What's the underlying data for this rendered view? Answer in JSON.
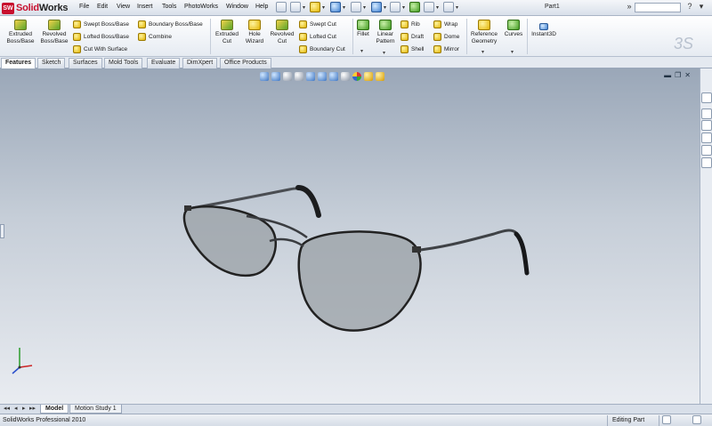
{
  "app": {
    "name_prefix": "Solid",
    "name_suffix": "Works",
    "logo_badge": "SW"
  },
  "menu": [
    "File",
    "Edit",
    "View",
    "Insert",
    "Tools",
    "PhotoWorks",
    "Window",
    "Help"
  ],
  "document_title": "Part1",
  "ribbon": {
    "extruded_boss": "Extruded Boss/Base",
    "revolved_boss": "Revolved Boss/Base",
    "swept_boss": "Swept Boss/Base",
    "lofted_boss": "Lofted Boss/Base",
    "boundary_boss": "Boundary Boss/Base",
    "cut_with_surface": "Cut With Surface",
    "combine": "Combine",
    "extruded_cut": "Extruded Cut",
    "hole_wizard": "Hole Wizard",
    "revolved_cut": "Revolved Cut",
    "swept_cut": "Swept Cut",
    "lofted_cut": "Lofted Cut",
    "boundary_cut": "Boundary Cut",
    "fillet": "Fillet",
    "linear_pattern": "Linear Pattern",
    "rib": "Rib",
    "draft": "Draft",
    "shell": "Shell",
    "wrap": "Wrap",
    "dome": "Dome",
    "mirror": "Mirror",
    "reference_geometry": "Reference Geometry",
    "curves": "Curves",
    "instant3d": "Instant3D"
  },
  "tabs": [
    "Features",
    "Sketch",
    "Surfaces",
    "Mold Tools",
    "Evaluate",
    "DimXpert",
    "Office Products"
  ],
  "bottom_tabs": [
    "Model",
    "Motion Study 1"
  ],
  "status": {
    "left": "SolidWorks Professional 2010",
    "mode": "Editing Part"
  },
  "colors": {
    "viewport_top": "#9aa7b8",
    "viewport_bottom": "#e9ecf1",
    "logo_red": "#c8102e"
  },
  "icons": {
    "triad": "xyz-triad-icon",
    "model": "sunglasses-3d-model"
  }
}
